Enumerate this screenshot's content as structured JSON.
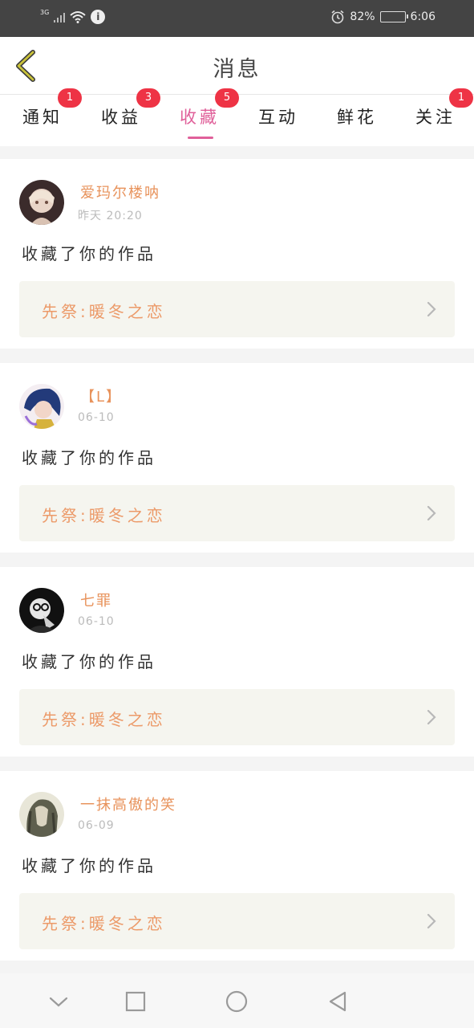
{
  "status_bar": {
    "network_type": "3G",
    "battery_percent": "82%",
    "battery_level": 0.82,
    "time": "6:06",
    "icons": [
      "signal-icon",
      "wifi-icon",
      "info-icon",
      "alarm-icon",
      "battery-icon"
    ]
  },
  "header": {
    "title": "消息",
    "back_icon": "chevron-left-icon"
  },
  "colors": {
    "accent": "#e0609a",
    "name": "#e8935c",
    "work_title": "#ec9a69",
    "badge": "#ee3345",
    "status_bar": "#444444",
    "back_arrow": "#c9c23a"
  },
  "tabs": [
    {
      "label": "通知",
      "badge": "1",
      "active": false
    },
    {
      "label": "收益",
      "badge": "3",
      "active": false
    },
    {
      "label": "收藏",
      "badge": "5",
      "active": true
    },
    {
      "label": "互动",
      "badge": "",
      "active": false
    },
    {
      "label": "鲜花",
      "badge": "",
      "active": false
    },
    {
      "label": "关注",
      "badge": "1",
      "active": false
    }
  ],
  "messages": [
    {
      "name": "爱玛尔楼呐",
      "time": "昨天  20:20",
      "action": "收藏了你的作品",
      "work_title": "先祭:暖冬之恋",
      "avatar": "avatar-image",
      "chevron": "chevron-right-icon"
    },
    {
      "name": "【L】",
      "time": "06-10",
      "action": "收藏了你的作品",
      "work_title": "先祭:暖冬之恋",
      "avatar": "avatar-image",
      "chevron": "chevron-right-icon"
    },
    {
      "name": "七罪",
      "time": "06-10",
      "action": "收藏了你的作品",
      "work_title": "先祭:暖冬之恋",
      "avatar": "avatar-image",
      "chevron": "chevron-right-icon"
    },
    {
      "name": "一抹高傲的笑",
      "time": "06-09",
      "action": "收藏了你的作品",
      "work_title": "先祭:暖冬之恋",
      "avatar": "avatar-image",
      "chevron": "chevron-right-icon"
    }
  ],
  "nav_bar": {
    "icons": [
      "chevron-down-icon",
      "square-icon",
      "circle-icon",
      "triangle-back-icon"
    ]
  }
}
